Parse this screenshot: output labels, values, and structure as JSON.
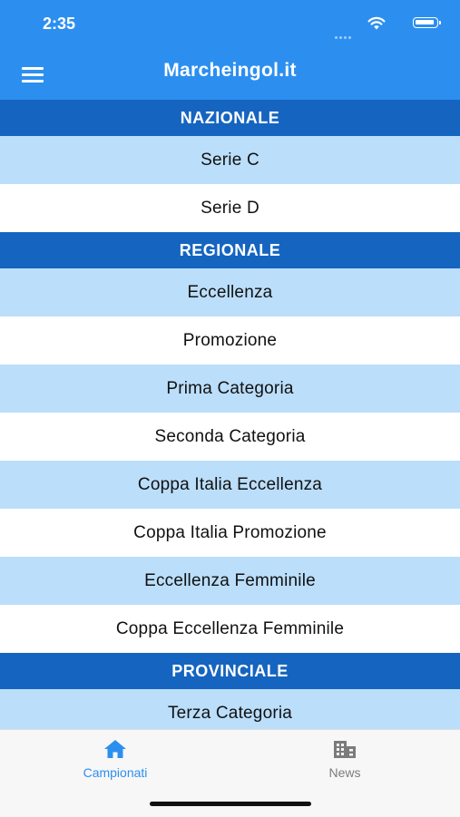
{
  "status_bar": {
    "time": "2:35"
  },
  "header": {
    "title": "Marcheingol.it",
    "menu_icon": "hamburger-menu-icon"
  },
  "sections": [
    {
      "title": "NAZIONALE",
      "items": [
        "Serie C",
        "Serie D"
      ]
    },
    {
      "title": "REGIONALE",
      "items": [
        "Eccellenza",
        "Promozione",
        "Prima Categoria",
        "Seconda Categoria",
        "Coppa Italia Eccellenza",
        "Coppa Italia Promozione",
        "Eccellenza Femminile",
        "Coppa Eccellenza Femminile"
      ]
    },
    {
      "title": "PROVINCIALE",
      "items": [
        "Terza Categoria"
      ]
    }
  ],
  "tabbar": {
    "tabs": [
      {
        "label": "Campionati",
        "icon": "home-icon",
        "active": true
      },
      {
        "label": "News",
        "icon": "building-icon",
        "active": false
      }
    ]
  },
  "colors": {
    "primary": "#2c8ff0",
    "section_header": "#1565c0",
    "row_alt": "#bbdefb",
    "tab_inactive": "#7b7b7b"
  }
}
